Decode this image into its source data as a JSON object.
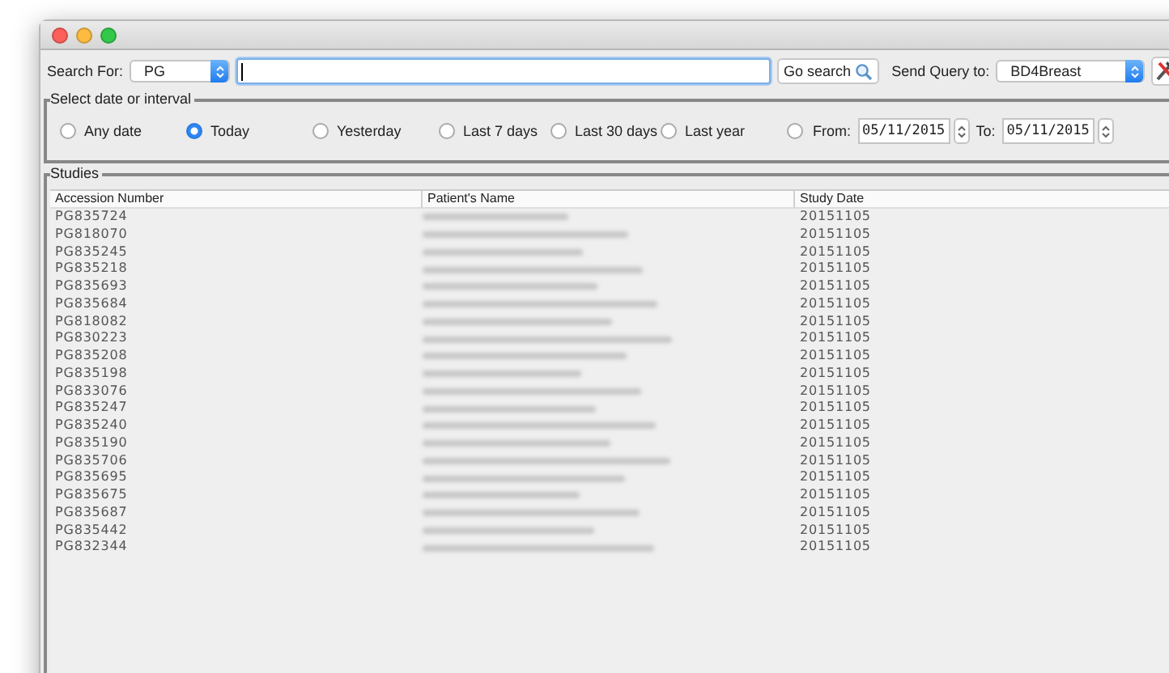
{
  "search": {
    "label": "Search For:",
    "type_value": "PG",
    "go_button": "Go search",
    "send_label": "Send Query to:",
    "destination": "BD4Breast"
  },
  "date_group": {
    "title": "Select date or interval",
    "options": [
      {
        "label": "Any date",
        "selected": false
      },
      {
        "label": "Today",
        "selected": true
      },
      {
        "label": "Yesterday",
        "selected": false
      },
      {
        "label": "Last 7 days",
        "selected": false
      },
      {
        "label": "Last 30 days",
        "selected": false
      },
      {
        "label": "Last year",
        "selected": false
      }
    ],
    "range": {
      "selected": false,
      "from_label": "From:",
      "from": "05/11/2015",
      "to_label": "To:",
      "to": "05/11/2015"
    }
  },
  "studies": {
    "title": "Studies",
    "columns": [
      "Accession Number",
      "Patient's Name",
      "Study Date"
    ],
    "rows": [
      {
        "accession": "PG835724",
        "date": "20151105"
      },
      {
        "accession": "PG818070",
        "date": "20151105"
      },
      {
        "accession": "PG835245",
        "date": "20151105"
      },
      {
        "accession": "PG835218",
        "date": "20151105"
      },
      {
        "accession": "PG835693",
        "date": "20151105"
      },
      {
        "accession": "PG835684",
        "date": "20151105"
      },
      {
        "accession": "PG818082",
        "date": "20151105"
      },
      {
        "accession": "PG830223",
        "date": "20151105"
      },
      {
        "accession": "PG835208",
        "date": "20151105"
      },
      {
        "accession": "PG835198",
        "date": "20151105"
      },
      {
        "accession": "PG833076",
        "date": "20151105"
      },
      {
        "accession": "PG835247",
        "date": "20151105"
      },
      {
        "accession": "PG835240",
        "date": "20151105"
      },
      {
        "accession": "PG835190",
        "date": "20151105"
      },
      {
        "accession": "PG835706",
        "date": "20151105"
      },
      {
        "accession": "PG835695",
        "date": "20151105"
      },
      {
        "accession": "PG835675",
        "date": "20151105"
      },
      {
        "accession": "PG835687",
        "date": "20151105"
      },
      {
        "accession": "PG835442",
        "date": "20151105"
      },
      {
        "accession": "PG832344",
        "date": "20151105"
      }
    ]
  }
}
